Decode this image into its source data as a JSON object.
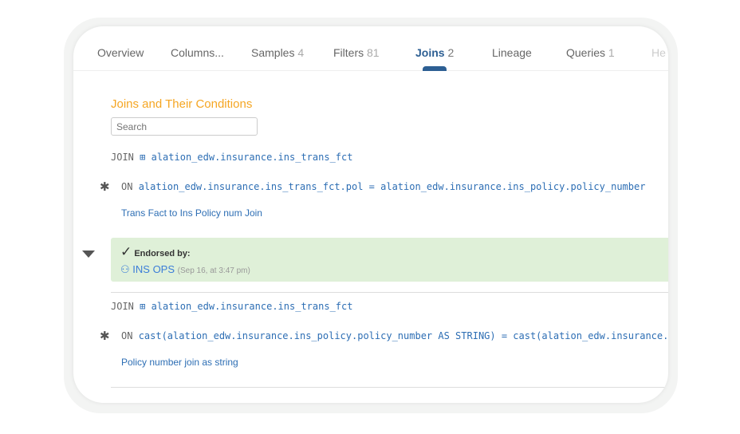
{
  "tabs": [
    {
      "label": "Overview",
      "count": ""
    },
    {
      "label": "Columns...",
      "count": ""
    },
    {
      "label": "Samples",
      "count": "4"
    },
    {
      "label": "Filters",
      "count": "81"
    },
    {
      "label": "Joins",
      "count": "2"
    },
    {
      "label": "Lineage",
      "count": ""
    },
    {
      "label": "Queries",
      "count": "1"
    },
    {
      "label": "He",
      "count": ""
    }
  ],
  "section_title": "Joins and Their Conditions",
  "search_placeholder": "Search",
  "joins": [
    {
      "join_kw": "JOIN",
      "table": "alation_edw.insurance.ins_trans_fct",
      "on_kw": "ON",
      "condition": "alation_edw.insurance.ins_trans_fct.pol = alation_edw.insurance.ins_policy.policy_number",
      "description": "Trans Fact to Ins Policy num Join"
    },
    {
      "join_kw": "JOIN",
      "table": "alation_edw.insurance.ins_trans_fct",
      "on_kw": "ON",
      "condition": "cast(alation_edw.insurance.ins_policy.policy_number AS STRING) = cast(alation_edw.insurance.ins_trans_fct.pol AS STRING)",
      "description": "Policy number join as string"
    }
  ],
  "endorsement": {
    "label": "Endorsed by:",
    "user": "INS OPS",
    "time": "(Sep 16, at 3:47 pm)"
  },
  "colors": {
    "accent": "#2d5f93",
    "title": "#f5a623",
    "endorse_bg": "#dff0d8"
  }
}
